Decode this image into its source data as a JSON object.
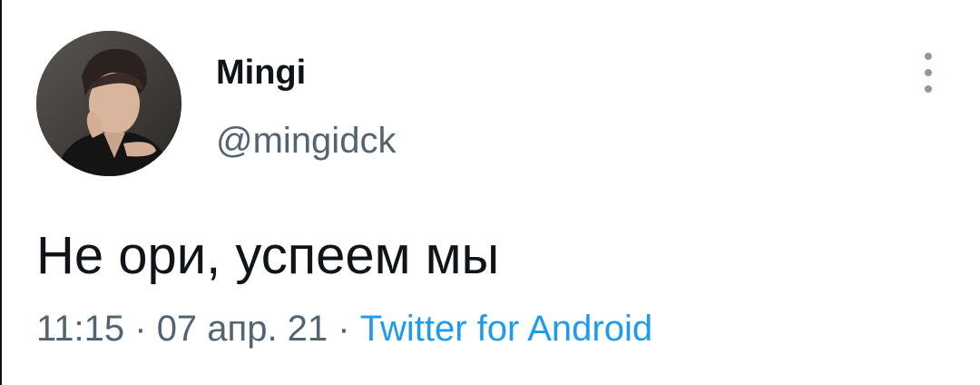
{
  "tweet": {
    "display_name": "Mingi",
    "handle": "@mingidck",
    "text": "Не ори, успеем мы",
    "time": "11:15",
    "separator": " · ",
    "date": "07 апр. 21",
    "source": "Twitter for Android"
  },
  "icons": {
    "more": "more-vertical-icon"
  },
  "colors": {
    "name": "#0f1419",
    "secondary": "#536471",
    "link": "#1d9bf0",
    "dots": "#8b98a5"
  }
}
